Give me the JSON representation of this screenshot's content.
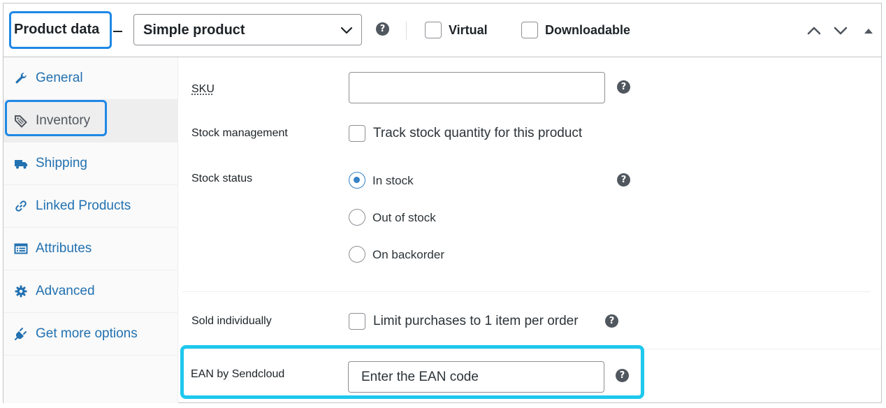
{
  "header": {
    "title": "Product data",
    "product_type": {
      "selected": "Simple product",
      "icon": "chevron-down-icon"
    },
    "help_icon": "?",
    "virtual_label": "Virtual",
    "virtual_checked": false,
    "downloadable_label": "Downloadable",
    "downloadable_checked": false,
    "controls": [
      "chevron-up-icon",
      "chevron-down-icon",
      "triangle-up-icon"
    ]
  },
  "sidebar": {
    "items": [
      {
        "label": "General",
        "icon": "wrench-icon",
        "active": false
      },
      {
        "label": "Inventory",
        "icon": "tag-icon",
        "active": true
      },
      {
        "label": "Shipping",
        "icon": "truck-icon",
        "active": false
      },
      {
        "label": "Linked Products",
        "icon": "link-icon",
        "active": false
      },
      {
        "label": "Attributes",
        "icon": "list-icon",
        "active": false
      },
      {
        "label": "Advanced",
        "icon": "gear-icon",
        "active": false
      },
      {
        "label": "Get more options",
        "icon": "plug-icon",
        "active": false
      }
    ]
  },
  "main": {
    "sku": {
      "label": "SKU",
      "value": ""
    },
    "stock_management": {
      "label": "Stock management",
      "checkbox_label": "Track stock quantity for this product",
      "checked": false
    },
    "stock_status": {
      "label": "Stock status",
      "options": [
        "In stock",
        "Out of stock",
        "On backorder"
      ],
      "selected": "In stock"
    },
    "sold_individually": {
      "label": "Sold individually",
      "checkbox_label": "Limit purchases to 1 item per order",
      "checked": false
    },
    "ean": {
      "label": "EAN by Sendcloud",
      "placeholder": "Enter the EAN code"
    }
  },
  "colors": {
    "link": "#2271b1",
    "highlight_blue": "#1e88e5",
    "highlight_cyan": "#1ec8ee",
    "radio_checked": "#3582c4",
    "help_icon_bg": "#50575e"
  }
}
